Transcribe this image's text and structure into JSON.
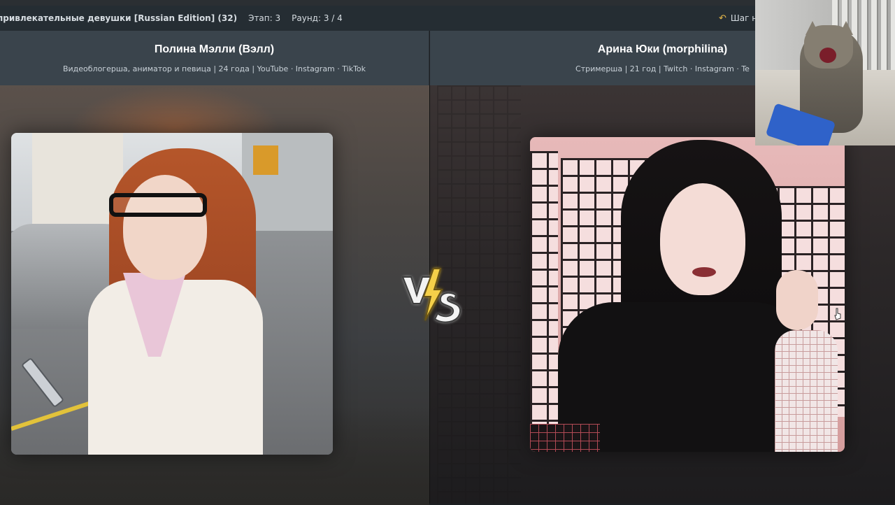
{
  "topbar": {
    "title": "привлекательные девушки [Russian Edition] (32)",
    "stage": "Этап: 3",
    "round": "Раунд: 3 / 4",
    "back_label": "Шаг на",
    "back_icon": "undo-icon"
  },
  "left": {
    "name": "Полина Мэлли (Вэлл)",
    "meta": "Видеоблогерша, аниматор и певица | 24 года | YouTube · Instagram · TikTok"
  },
  "right": {
    "name": "Арина Юки (morphilina)",
    "meta": "Стримерша | 21 год | Twitch · Instagram · Te"
  },
  "vs": {
    "icon": "vs-lightning-icon",
    "color": "#f5d04a"
  }
}
